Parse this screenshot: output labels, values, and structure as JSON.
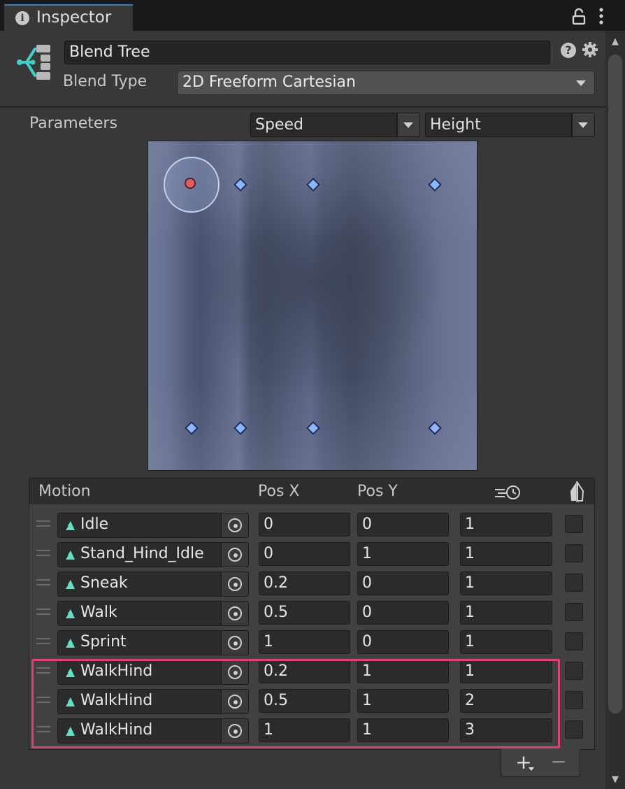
{
  "tab": {
    "title": "Inspector"
  },
  "header": {
    "name": "Blend Tree",
    "blend_type_label": "Blend Type",
    "blend_type": "2D Freeform Cartesian"
  },
  "parameters": {
    "label": "Parameters",
    "x_param": "Speed",
    "y_param": "Height"
  },
  "icons": {
    "tab": "info-icon",
    "lock": "lock-icon",
    "menu": "kebab-menu-icon",
    "component": "blend-tree-icon",
    "help": "help-icon",
    "settings": "gear-icon",
    "clip": "animation-clip-icon",
    "picker": "object-picker-icon",
    "threshold": "time-scale-icon",
    "mirror": "mirror-icon"
  },
  "graph": {
    "current_point": {
      "x": 0,
      "y": 1
    },
    "motion_points": [
      {
        "x": 0,
        "y": 0
      },
      {
        "x": 0,
        "y": 1
      },
      {
        "x": 0.2,
        "y": 0
      },
      {
        "x": 0.5,
        "y": 0
      },
      {
        "x": 1,
        "y": 0
      },
      {
        "x": 0.2,
        "y": 1
      },
      {
        "x": 0.5,
        "y": 1
      },
      {
        "x": 1,
        "y": 1
      }
    ]
  },
  "motion_list": {
    "headers": {
      "motion": "Motion",
      "pos_x": "Pos X",
      "pos_y": "Pos Y"
    },
    "rows": [
      {
        "motion": "Idle",
        "pos_x": "0",
        "pos_y": "0",
        "time_scale": "1",
        "mirror": false
      },
      {
        "motion": "Stand_Hind_Idle",
        "pos_x": "0",
        "pos_y": "1",
        "time_scale": "1",
        "mirror": false
      },
      {
        "motion": "Sneak",
        "pos_x": "0.2",
        "pos_y": "0",
        "time_scale": "1",
        "mirror": false
      },
      {
        "motion": "Walk",
        "pos_x": "0.5",
        "pos_y": "0",
        "time_scale": "1",
        "mirror": false
      },
      {
        "motion": "Sprint",
        "pos_x": "1",
        "pos_y": "0",
        "time_scale": "1",
        "mirror": false
      },
      {
        "motion": "WalkHind",
        "pos_x": "0.2",
        "pos_y": "1",
        "time_scale": "1",
        "mirror": false
      },
      {
        "motion": "WalkHind",
        "pos_x": "0.5",
        "pos_y": "1",
        "time_scale": "2",
        "mirror": false
      },
      {
        "motion": "WalkHind",
        "pos_x": "1",
        "pos_y": "1",
        "time_scale": "3",
        "mirror": false
      }
    ],
    "add_label": "+",
    "remove_label": "−"
  },
  "colors": {
    "highlight": "#e0407a",
    "accent": "#3a79bb",
    "current_point": "#e25c5c",
    "motion_point": "#8bb7ff"
  }
}
